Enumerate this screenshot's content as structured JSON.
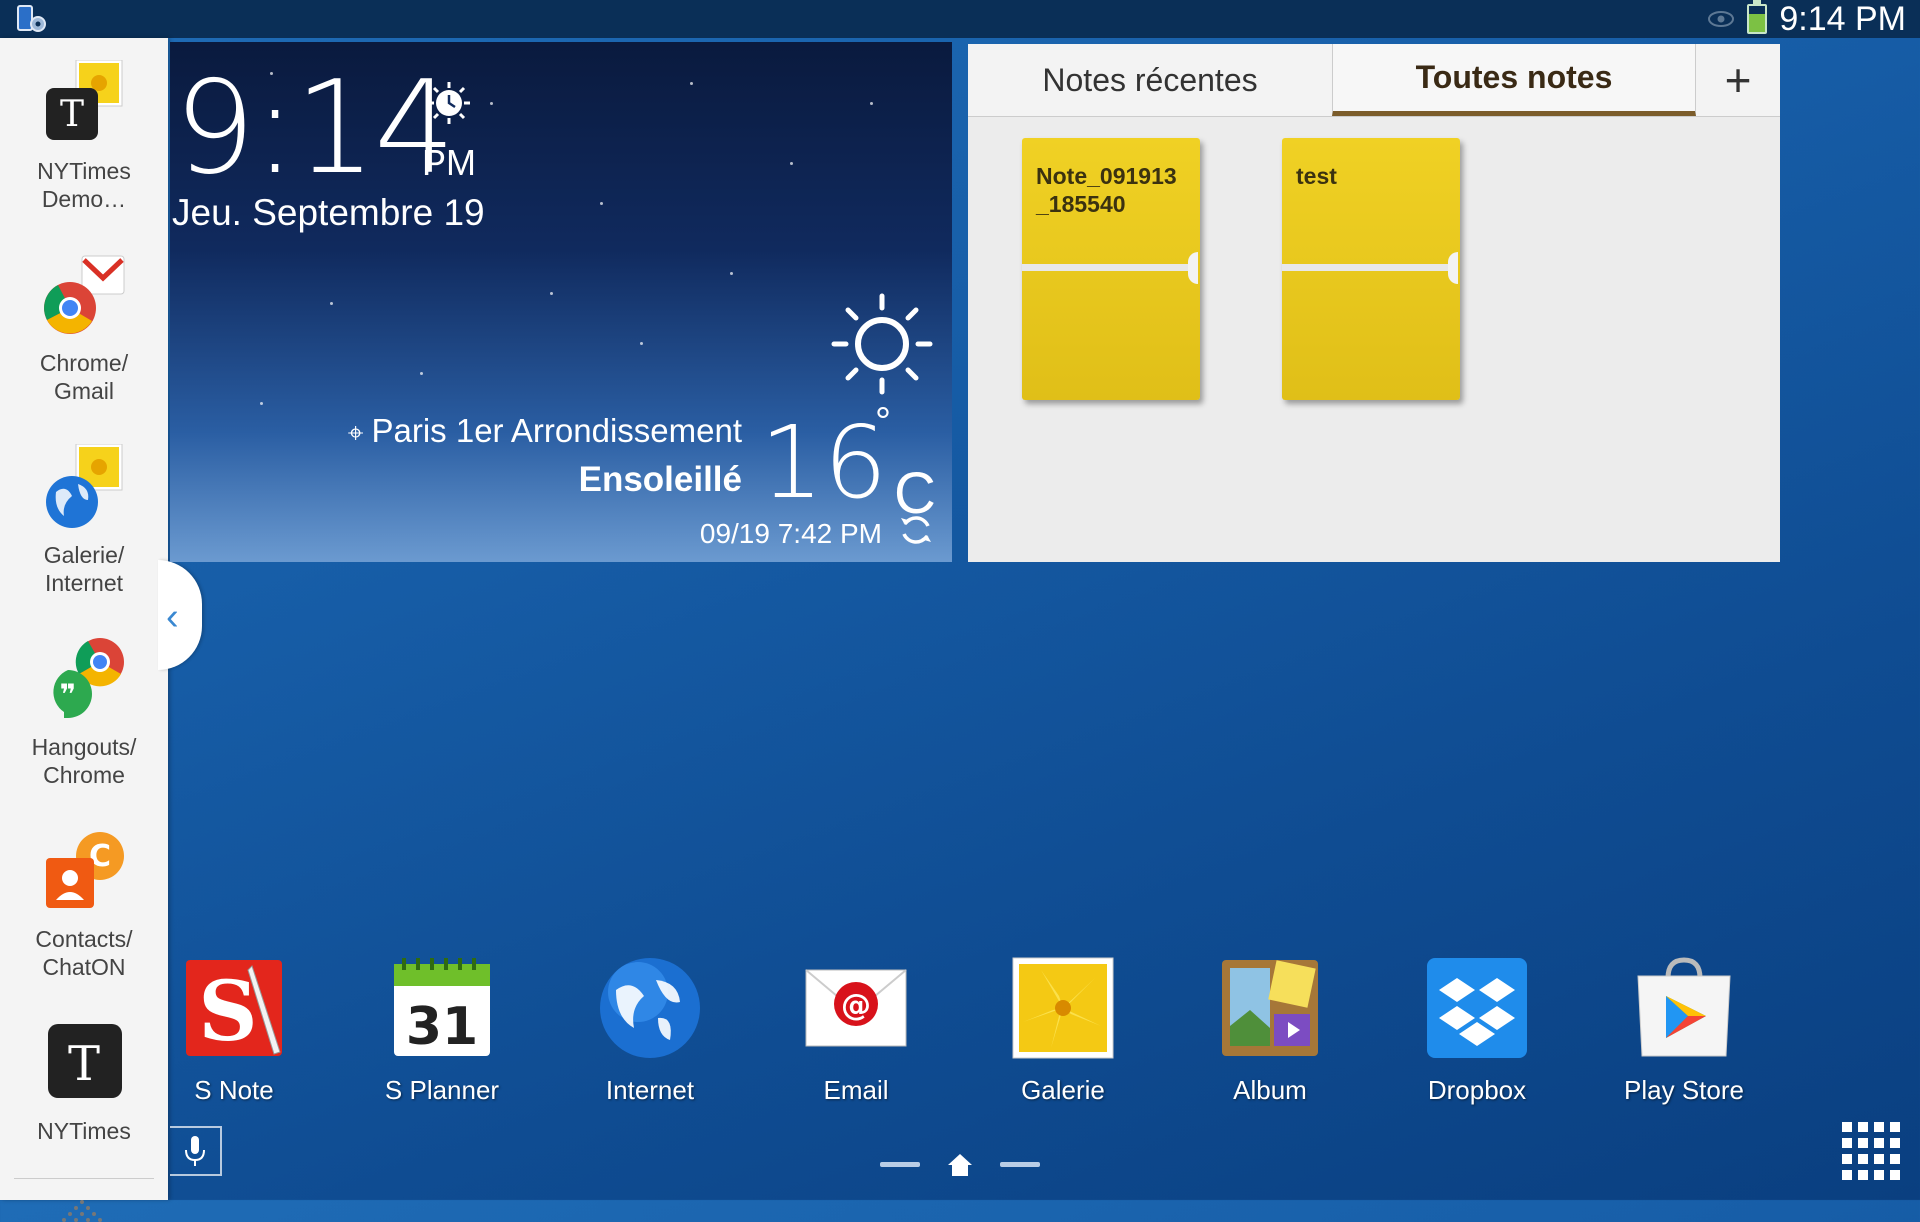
{
  "status_bar": {
    "time": "9:14 PM",
    "left_icon": "settings-tablet-icon",
    "eye_icon": "smart-stay-eye-icon",
    "battery_icon": "battery-icon"
  },
  "left_dock": {
    "items": [
      {
        "label": "NYTimes Demo...",
        "line1": "NYTimes",
        "line2": "Demo…",
        "icon": "nytimes-gallery-pair-icon"
      },
      {
        "label": "Chrome/Gmail",
        "line1": "Chrome/",
        "line2": "Gmail",
        "icon": "chrome-gmail-pair-icon"
      },
      {
        "label": "Galerie/Internet",
        "line1": "Galerie/",
        "line2": "Internet",
        "icon": "gallery-internet-pair-icon"
      },
      {
        "label": "Hangouts/Chrome",
        "line1": "Hangouts/",
        "line2": "Chrome",
        "icon": "hangouts-chrome-pair-icon"
      },
      {
        "label": "Contacts/ChatON",
        "line1": "Contacts/",
        "line2": "ChatON",
        "icon": "contacts-chaton-pair-icon"
      },
      {
        "label": "NYTimes",
        "line1": "NYTimes",
        "line2": "",
        "icon": "nytimes-icon"
      }
    ],
    "handle_icon": "chevron-left-icon"
  },
  "clock_widget": {
    "time": "9:14",
    "ampm": "PM",
    "date": "Jeu. Septembre 19",
    "location": "Paris 1er  Arrondissement",
    "condition": "Ensoleillé",
    "temperature": "16",
    "degree": "°",
    "unit": "C",
    "updated": "09/19 7:42 PM"
  },
  "notes_widget": {
    "tabs": [
      {
        "label": "Notes récentes"
      },
      {
        "label": "Toutes notes"
      }
    ],
    "add_label": "+",
    "notes": [
      {
        "title_line1": "Note_091913",
        "title_line2": "_185540"
      },
      {
        "title_line1": "test",
        "title_line2": ""
      }
    ]
  },
  "apps": [
    {
      "label": "S Note",
      "icon": "s-note-icon"
    },
    {
      "label": "S Planner",
      "icon": "s-planner-icon",
      "day": "31"
    },
    {
      "label": "Internet",
      "icon": "internet-globe-icon"
    },
    {
      "label": "Email",
      "icon": "email-icon"
    },
    {
      "label": "Galerie",
      "icon": "gallery-icon"
    },
    {
      "label": "Album",
      "icon": "album-icon"
    },
    {
      "label": "Dropbox",
      "icon": "dropbox-icon"
    },
    {
      "label": "Play Store",
      "icon": "play-store-icon"
    }
  ],
  "colors": {
    "accent_tab": "#7b5c2a",
    "note_yellow": "#e6c81c",
    "wallpaper": "#175ea8"
  }
}
